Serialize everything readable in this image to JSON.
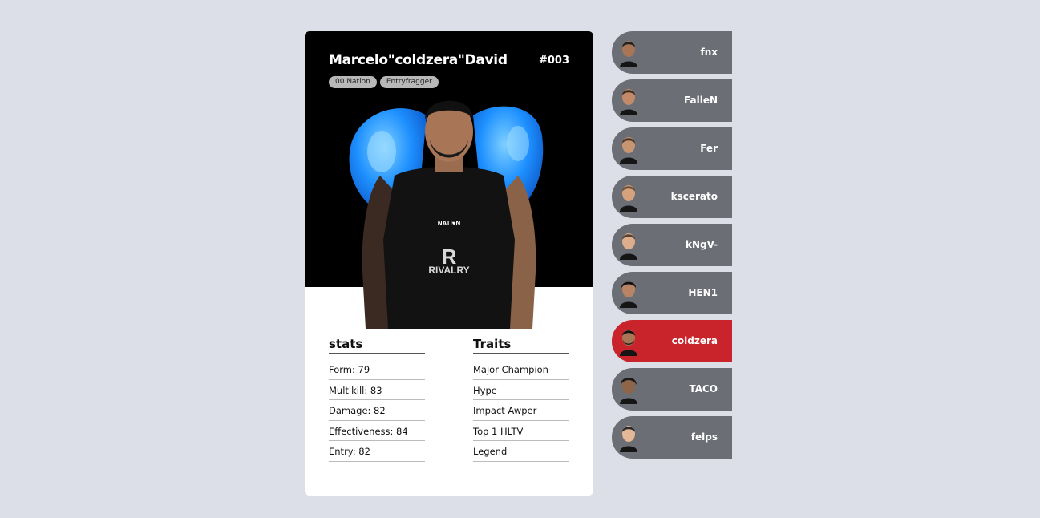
{
  "card": {
    "name": "Marcelo\"coldzera\"David",
    "number": "#003",
    "tags": [
      "00 Nation",
      "Entryfragger"
    ],
    "stats_title": "stats",
    "stats": [
      "Form: 79",
      "Multikill: 83",
      "Damage: 82",
      "Effectiveness: 84",
      "Entry: 82"
    ],
    "traits_title": "Traits",
    "traits": [
      "Major Champion",
      "Hype",
      "Impact Awper",
      "Top 1 HLTV",
      "Legend"
    ]
  },
  "roster": [
    {
      "label": "fnx",
      "active": false
    },
    {
      "label": "FalleN",
      "active": false
    },
    {
      "label": "Fer",
      "active": false
    },
    {
      "label": "kscerato",
      "active": false
    },
    {
      "label": "kNgV-",
      "active": false
    },
    {
      "label": "HEN1",
      "active": false
    },
    {
      "label": "coldzera",
      "active": true
    },
    {
      "label": "TACO",
      "active": false
    },
    {
      "label": "felps",
      "active": false
    }
  ],
  "colors": {
    "background": "#dcdfe7",
    "roster_item": "#6b6e75",
    "roster_active": "#c9242b",
    "wings": "#1e90ff"
  },
  "icons": {
    "portrait": "player-portrait",
    "avatar": "player-avatar-icon"
  }
}
